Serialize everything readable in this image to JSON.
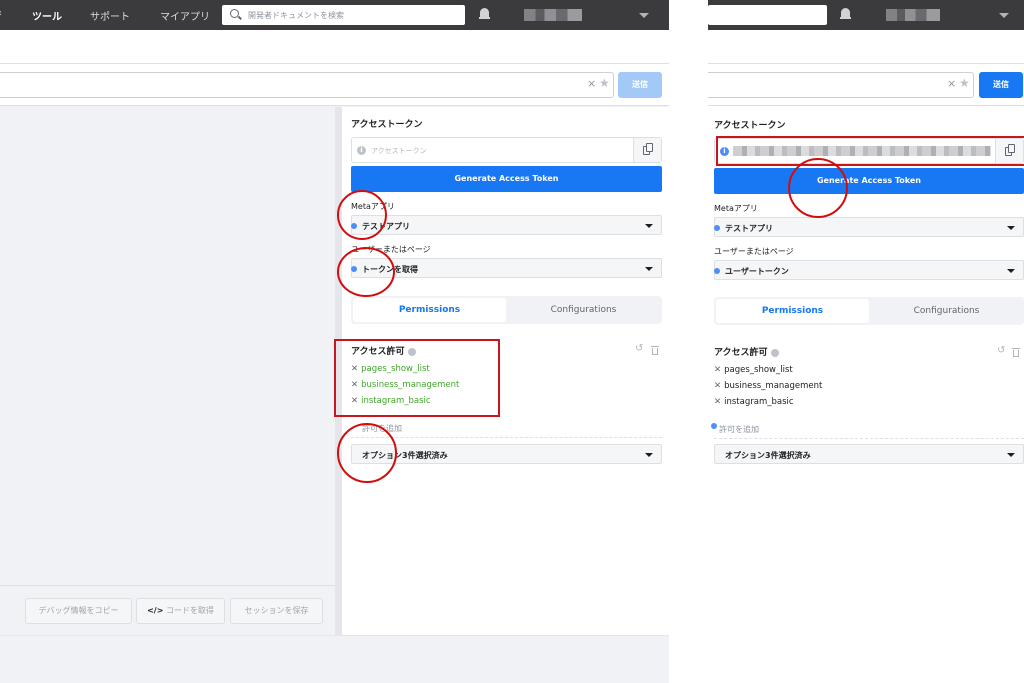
{
  "panel_a": {
    "topbar": {
      "nav_tools": "ツール",
      "nav_support": "サポート",
      "nav_myapps": "マイアプリ",
      "search_placeholder": "開発者ドキュメントを検索"
    },
    "url_bar": {
      "send_label": "送信"
    },
    "footer": {
      "copy_debug_label": "デバッグ情報をコピー",
      "get_code_label": "コードを取得",
      "save_session_label": "セッションを保存"
    },
    "access_token": {
      "title": "アクセストークン",
      "placeholder": "アクセストークン",
      "generate_label": "Generate Access Token"
    },
    "meta_app": {
      "label": "Metaアプリ",
      "value": "テストアプリ"
    },
    "user_or_page": {
      "label": "ユーザーまたはページ",
      "value": "トークンを取得"
    },
    "tabs": {
      "permissions": "Permissions",
      "configurations": "Configurations"
    },
    "permissions": {
      "title": "アクセス許可",
      "items": [
        "pages_show_list",
        "business_management",
        "instagram_basic"
      ],
      "add_label": "許可を追加",
      "options_value": "オプション3件選択済み"
    }
  },
  "panel_b": {
    "url_bar": {
      "send_label": "送信"
    },
    "access_token": {
      "title": "アクセストークン",
      "generate_label": "Generate Access Token"
    },
    "meta_app": {
      "label": "Metaアプリ",
      "value": "テストアプリ"
    },
    "user_or_page": {
      "label": "ユーザーまたはページ",
      "value": "ユーザートークン"
    },
    "tabs": {
      "permissions": "Permissions",
      "configurations": "Configurations"
    },
    "permissions": {
      "title": "アクセス許可",
      "items": [
        "pages_show_list",
        "business_management",
        "instagram_basic"
      ],
      "add_label": "許可を追加",
      "options_value": "オプション3件選択済み"
    }
  },
  "colors": {
    "topbar": "#3b3b3d",
    "primary_button": "#1877f2",
    "disabled_button": "#a3c9f7",
    "annotation_red": "#d10e0e",
    "permission_green": "#42a52b"
  }
}
